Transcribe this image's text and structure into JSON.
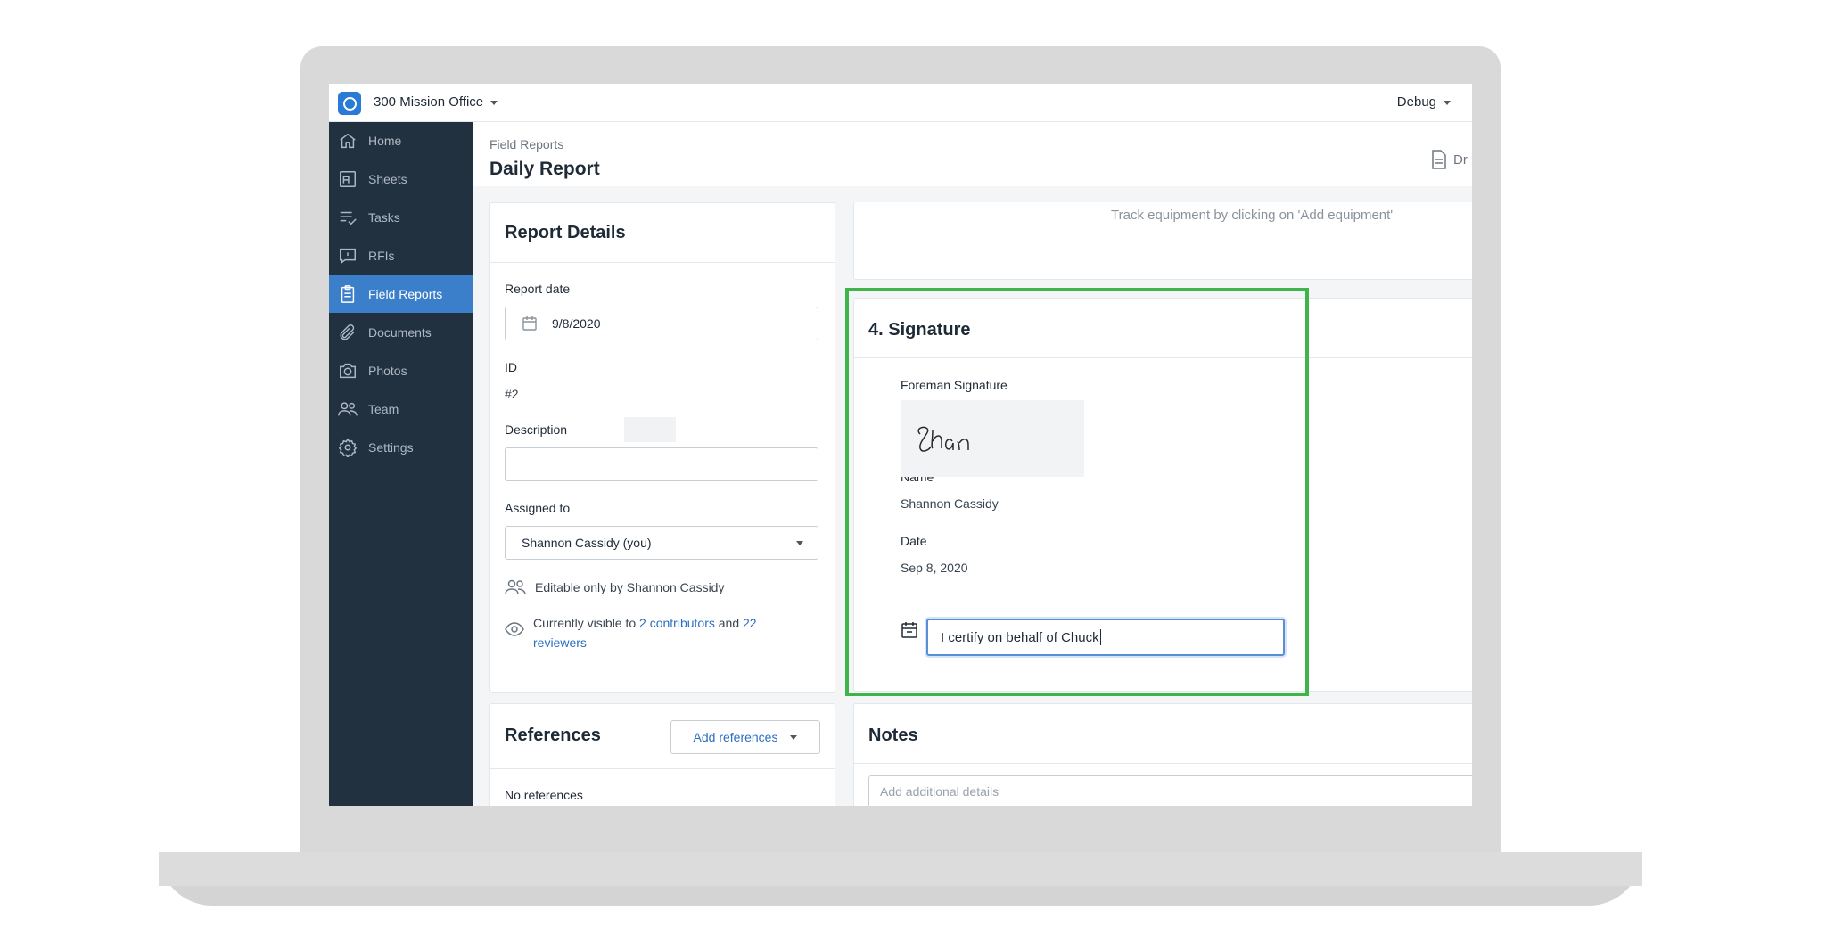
{
  "topbar": {
    "project": "300 Mission Office",
    "debug": "Debug"
  },
  "sidebar": {
    "items": [
      {
        "label": "Home",
        "icon": "home-icon"
      },
      {
        "label": "Sheets",
        "icon": "sheets-icon"
      },
      {
        "label": "Tasks",
        "icon": "tasks-icon"
      },
      {
        "label": "RFIs",
        "icon": "rfis-icon"
      },
      {
        "label": "Field Reports",
        "icon": "clipboard-icon",
        "active": true
      },
      {
        "label": "Documents",
        "icon": "paperclip-icon"
      },
      {
        "label": "Photos",
        "icon": "camera-icon"
      },
      {
        "label": "Team",
        "icon": "team-icon"
      },
      {
        "label": "Settings",
        "icon": "gear-icon"
      }
    ]
  },
  "header": {
    "breadcrumb": "Field Reports",
    "title": "Daily Report",
    "right_text": "Dr"
  },
  "details": {
    "title": "Report Details",
    "date_label": "Report date",
    "date_value": "9/8/2020",
    "id_label": "ID",
    "id_value": "#2",
    "description_label": "Description",
    "assigned_label": "Assigned to",
    "assigned_value": "Shannon Cassidy (you)",
    "editable_text": "Editable only by Shannon Cassidy",
    "visible_prefix": "Currently visible to",
    "visible_link1": "2 contributors",
    "visible_and": "and",
    "visible_link2": "22",
    "visible_link3": "reviewers"
  },
  "equipment": {
    "hint": "Track equipment by clicking on 'Add equipment'"
  },
  "signature": {
    "title": "4. Signature",
    "foreman_label": "Foreman Signature",
    "signature_scribble": "Shan",
    "name_label": "Name",
    "name_value": "Shannon Cassidy",
    "date_label": "Date",
    "date_value": "Sep 8, 2020",
    "certify_value": "I certify on behalf of Chuck"
  },
  "references": {
    "title": "References",
    "add_button": "Add references",
    "empty": "No references"
  },
  "notes": {
    "title": "Notes",
    "placeholder": "Add additional details"
  },
  "colors": {
    "sidebar": "#22313f",
    "active": "#3b7ec9",
    "highlight": "#3fb44b",
    "link": "#2a6fc2"
  }
}
